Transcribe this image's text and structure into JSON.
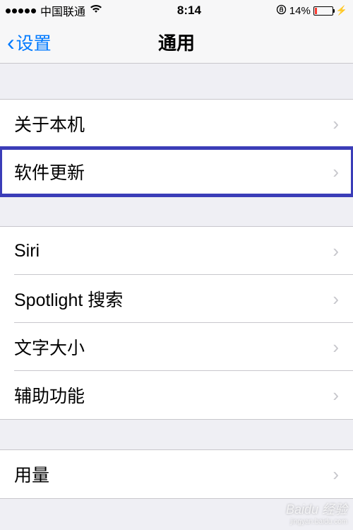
{
  "status_bar": {
    "carrier": "中国联通",
    "time": "8:14",
    "battery_percent": "14%"
  },
  "nav": {
    "back_label": "设置",
    "title": "通用"
  },
  "group1": {
    "items": [
      {
        "label": "关于本机"
      },
      {
        "label": "软件更新"
      }
    ]
  },
  "group2": {
    "items": [
      {
        "label": "Siri"
      },
      {
        "label": "Spotlight 搜索"
      },
      {
        "label": "文字大小"
      },
      {
        "label": "辅助功能"
      }
    ]
  },
  "group3": {
    "items": [
      {
        "label": "用量"
      }
    ]
  },
  "watermark": {
    "brand": "Baidu 经验",
    "url": "jingyan.baidu.com"
  }
}
